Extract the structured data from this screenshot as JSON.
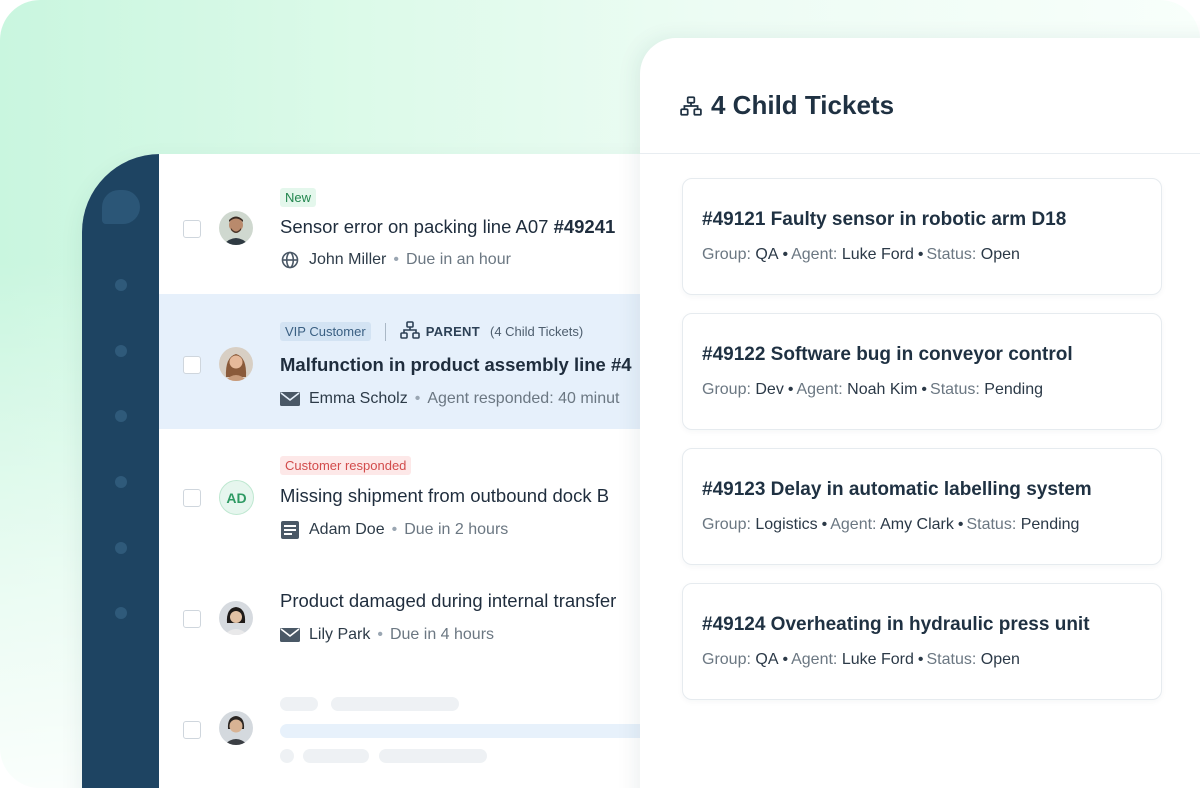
{
  "colors": {
    "rail": "#1e4462",
    "selected_row": "#e6f0fb",
    "new_tag": "#22864e",
    "vip_tag": "#3a5f82",
    "customer_tag": "#d24b4b",
    "accent_green": "#2e9a63"
  },
  "tickets": [
    {
      "tag": "New",
      "title": "Sensor error on packing line A07 ",
      "number": "#49241",
      "meta_icon": "globe-icon",
      "person": "John Miller",
      "status": "Due in an hour"
    },
    {
      "tag": "VIP Customer",
      "parent_label": "PARENT",
      "parent_count": "(4 Child Tickets)",
      "title": "Malfunction in product assembly line #4",
      "meta_icon": "mail-icon",
      "person": "Emma Scholz",
      "status": "Agent responded: 40 minut"
    },
    {
      "tag": "Customer responded",
      "avatar_initials": "AD",
      "title": "Missing shipment from outbound dock B",
      "meta_icon": "form-icon",
      "person": "Adam Doe",
      "status": "Due in 2 hours"
    },
    {
      "title": "Product damaged during internal transfer",
      "meta_icon": "mail-icon",
      "person": "Lily Park",
      "status": "Due in 4 hours"
    }
  ],
  "child_panel": {
    "title": "4 Child Tickets",
    "labels": {
      "group": "Group:",
      "agent": "Agent:",
      "status": "Status:"
    },
    "children": [
      {
        "title": "#49121 Faulty sensor in robotic arm D18",
        "group": "QA",
        "agent": "Luke Ford",
        "status": "Open"
      },
      {
        "title": "#49122 Software bug in conveyor control",
        "group": "Dev",
        "agent": "Noah Kim",
        "status": "Pending"
      },
      {
        "title": "#49123 Delay in automatic labelling system",
        "group": "Logistics",
        "agent": "Amy Clark",
        "status": "Pending"
      },
      {
        "title": "#49124 Overheating in hydraulic press unit",
        "group": "QA",
        "agent": "Luke Ford",
        "status": "Open"
      }
    ]
  }
}
